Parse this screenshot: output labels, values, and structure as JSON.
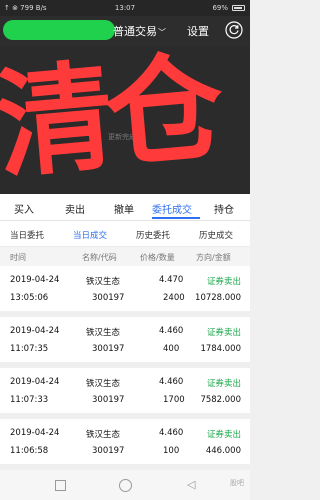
{
  "status_bar": {
    "left": "↑ ⊗ 799 B/s",
    "time": "13:07",
    "battery": "69%"
  },
  "header": {
    "title": "普通交易",
    "chevron": "﹀",
    "settings": "设置"
  },
  "banner": {
    "big_text": "清仓",
    "faint_text": "更新完成."
  },
  "trade_tabs": [
    "买入",
    "卖出",
    "撤单",
    "委托成交",
    "持仓"
  ],
  "sub_tabs": [
    "当日委托",
    "当日成交",
    "历史委托",
    "历史成交"
  ],
  "columns": [
    "时间",
    "名称/代码",
    "价格/数量",
    "方向/金额"
  ],
  "rows": [
    {
      "date": "2019-04-24",
      "time": "13:05:06",
      "name": "铁汉生态",
      "code": "300197",
      "price": "4.470",
      "qty": "2400",
      "direction": "证券卖出",
      "amount": "10728.000"
    },
    {
      "date": "2019-04-24",
      "time": "11:07:35",
      "name": "铁汉生态",
      "code": "300197",
      "price": "4.460",
      "qty": "400",
      "direction": "证券卖出",
      "amount": "1784.000"
    },
    {
      "date": "2019-04-24",
      "time": "11:07:33",
      "name": "铁汉生态",
      "code": "300197",
      "price": "4.460",
      "qty": "1700",
      "direction": "证券卖出",
      "amount": "7582.000"
    },
    {
      "date": "2019-04-24",
      "time": "11:06:58",
      "name": "铁汉生态",
      "code": "300197",
      "price": "4.460",
      "qty": "100",
      "direction": "证券卖出",
      "amount": "446.000"
    }
  ],
  "watermark": "股吧",
  "colors": {
    "accent": "#2f6ff0",
    "sell_green": "#1aa84b",
    "banner_red": "#ff3a3a",
    "blob_green": "#1fd14d"
  }
}
